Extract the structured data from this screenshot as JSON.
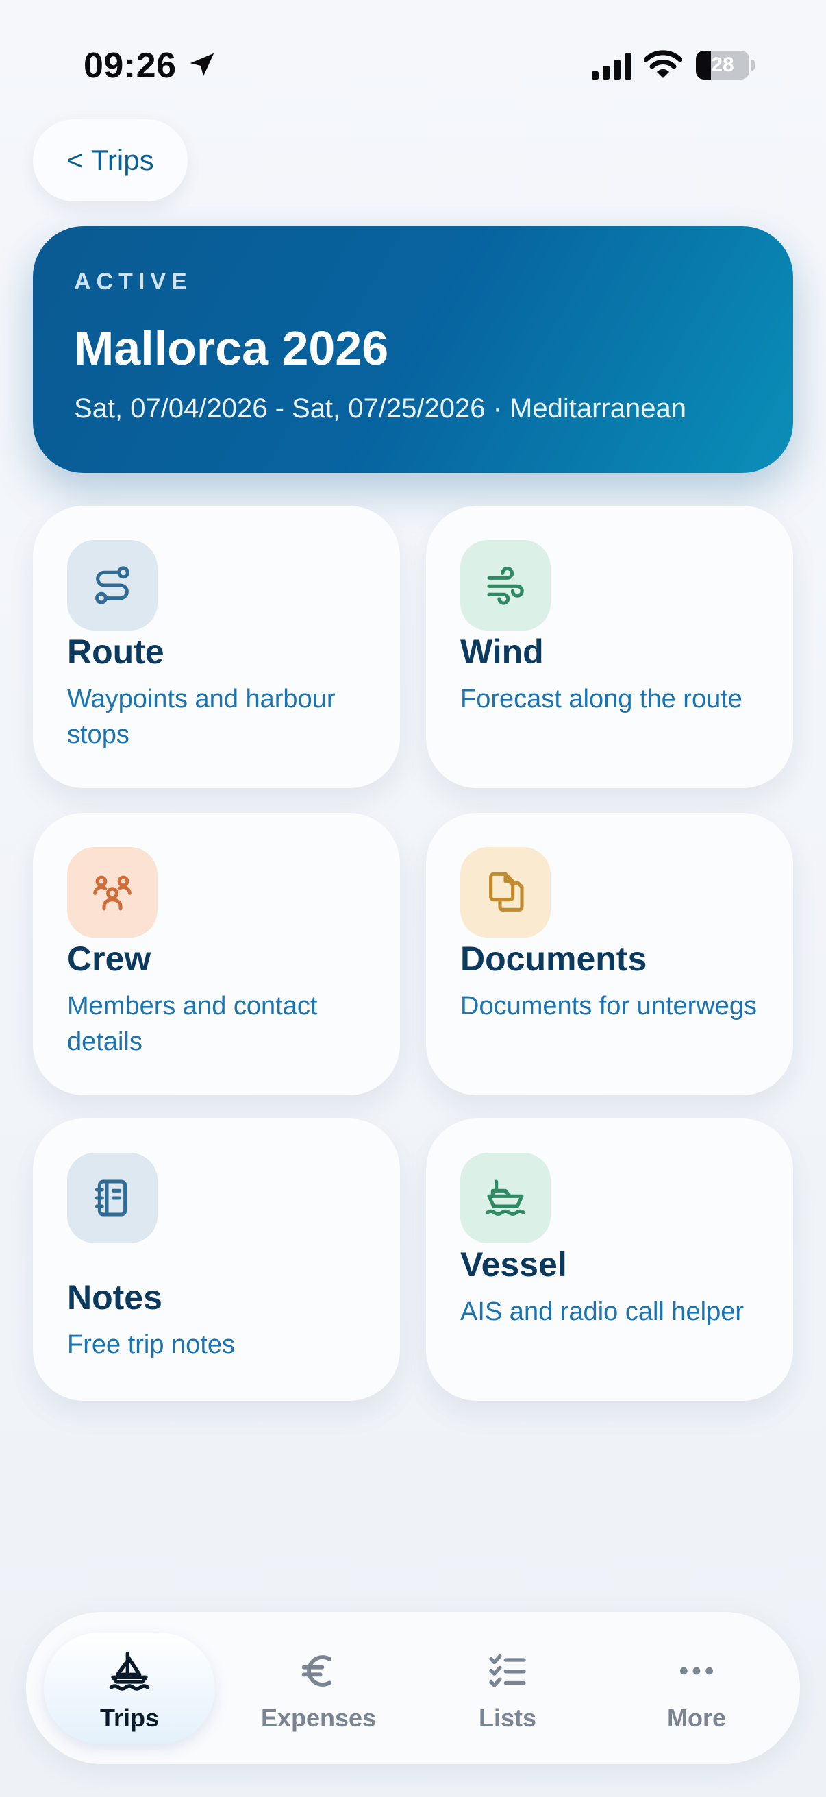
{
  "status_bar": {
    "time": "09:26",
    "battery": "28",
    "battery_level": 0.28
  },
  "nav": {
    "back_label": "< Trips"
  },
  "trip": {
    "status": "ACTIVE",
    "title": "Mallorca 2026",
    "subtitle": "Sat, 07/04/2026 - Sat, 07/25/2026 · Meditarranean"
  },
  "cards": [
    {
      "title": "Route",
      "description": "Waypoints and harbour stops",
      "icon": "route-icon",
      "icon_bg": "#dde8f1",
      "icon_color": "#2f6c95"
    },
    {
      "title": "Wind",
      "description": "Forecast along the route",
      "icon": "wind-icon",
      "icon_bg": "#dbf0e7",
      "icon_color": "#2e8a63"
    },
    {
      "title": "Crew",
      "description": "Members and contact details",
      "icon": "crew-icon",
      "icon_bg": "#fbe2d3",
      "icon_color": "#cf6e3a"
    },
    {
      "title": "Documents",
      "description": "Documents for unterwegs",
      "icon": "documents-icon",
      "icon_bg": "#f9ead0",
      "icon_color": "#c08a2e"
    },
    {
      "title": "Notes",
      "description": "Free trip notes",
      "icon": "notebook-icon",
      "icon_bg": "#dde8f1",
      "icon_color": "#2f6c95"
    },
    {
      "title": "Vessel",
      "description": "AIS and radio call helper",
      "icon": "ship-icon",
      "icon_bg": "#dbf0e7",
      "icon_color": "#2e8a63"
    }
  ],
  "tabs": [
    {
      "label": "Trips",
      "icon": "sailboat-icon",
      "active": true
    },
    {
      "label": "Expenses",
      "icon": "euro-icon",
      "active": false
    },
    {
      "label": "Lists",
      "icon": "checklist-icon",
      "active": false
    },
    {
      "label": "More",
      "icon": "more-icon",
      "active": false
    }
  ],
  "colors": {
    "accent": "#07639f",
    "card_title": "#0c3a5e",
    "card_desc": "#1a74b3",
    "tab_inactive": "#7b8492"
  }
}
